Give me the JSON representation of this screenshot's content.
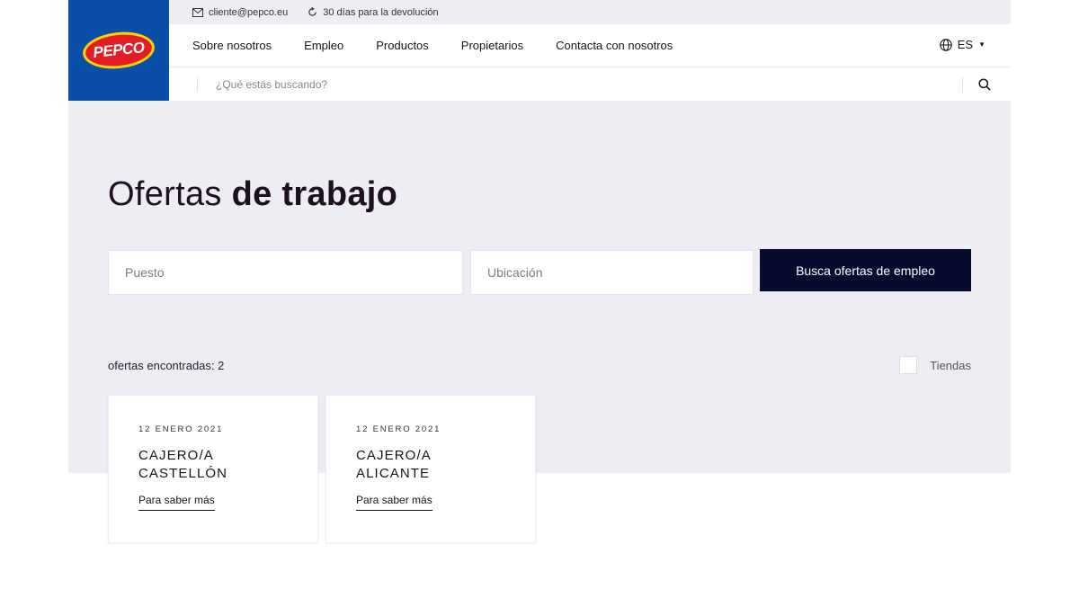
{
  "brand": {
    "logo_text": "PEPCO",
    "primary_color": "#0a4ea8",
    "accent_color": "#e41c24",
    "accent_yellow": "#ffd200"
  },
  "topbar": {
    "email": "cliente@pepco.eu",
    "email_icon": "mail-icon",
    "returns": "30 días para la devolución",
    "returns_icon": "refresh-icon"
  },
  "nav": {
    "items": [
      {
        "label": "Sobre nosotros"
      },
      {
        "label": "Empleo"
      },
      {
        "label": "Productos"
      },
      {
        "label": "Propietarios"
      },
      {
        "label": "Contacta con nosotros"
      }
    ],
    "language": "ES",
    "language_icon": "globe-icon"
  },
  "search": {
    "placeholder": "¿Qué estás buscando?",
    "icon": "search-icon"
  },
  "page": {
    "title_light": "Ofertas ",
    "title_bold": "de trabajo"
  },
  "filters": {
    "position_placeholder": "Puesto",
    "location_placeholder": "Ubicación",
    "submit_label": "Busca ofertas de empleo",
    "submit_color": "#070b2e"
  },
  "results": {
    "count_label": "ofertas encontradas: 2",
    "stores_label": "Tiendas"
  },
  "jobs": [
    {
      "date": "12 ENERO 2021",
      "title": "CAJERO/A CASTELLÓN",
      "link": "Para saber más"
    },
    {
      "date": "12 ENERO 2021",
      "title": "CAJERO/A ALICANTE",
      "link": "Para saber más"
    }
  ]
}
